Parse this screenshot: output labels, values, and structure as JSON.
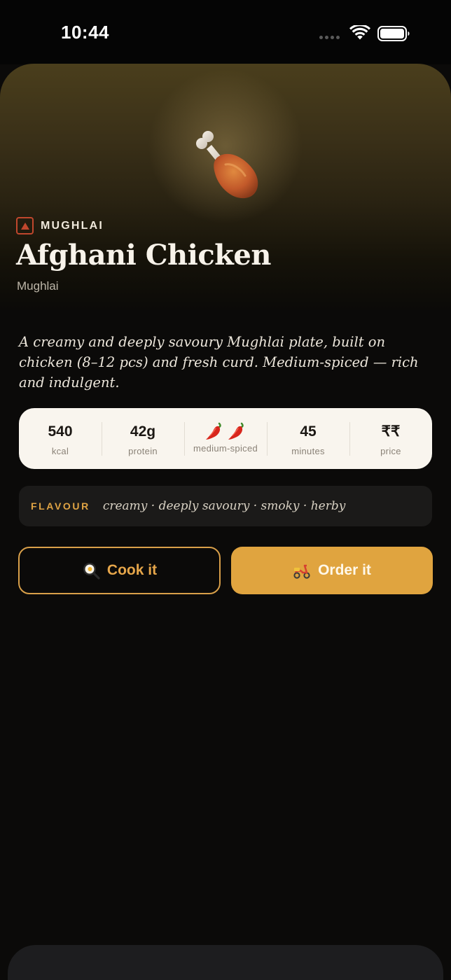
{
  "status_bar": {
    "time": "10:44"
  },
  "hero": {
    "icon": "drumstick-icon",
    "cuisine_tag": "MUGHLAI",
    "title": "Afghani Chicken",
    "subtitle": "Mughlai"
  },
  "description": "A creamy and deeply savoury Mughlai plate, built on chicken (8–12 pcs) and fresh curd. Medium-spiced — rich and indulgent.",
  "stats": [
    {
      "value": "540",
      "label": "kcal"
    },
    {
      "value": "42g",
      "label": "protein"
    },
    {
      "icon": "chili-icon",
      "count": 2,
      "label": "medium-spiced"
    },
    {
      "value": "45",
      "label": "minutes"
    },
    {
      "value": "₹₹",
      "label": "price"
    }
  ],
  "flavour": {
    "label": "FLAVOUR",
    "notes": "creamy · deeply savoury · smoky · herby"
  },
  "actions": {
    "cook": {
      "label": "Cook it",
      "icon": "frying-pan-icon"
    },
    "order": {
      "label": "Order it",
      "icon": "scooter-icon"
    }
  },
  "colors": {
    "accent": "#e0a43f",
    "cuisine_icon": "#c0472d",
    "background": "#0b0a09",
    "card": "#f9f5ee"
  }
}
